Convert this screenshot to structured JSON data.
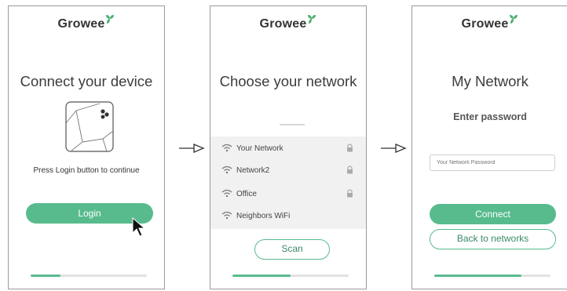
{
  "brand": {
    "name": "Growee",
    "accent": "#58bb8e"
  },
  "screen1": {
    "title": "Connect your device",
    "hint": "Press Login button to continue",
    "login_label": "Login",
    "progress": 0.26
  },
  "screen2": {
    "title": "Choose your network",
    "networks": [
      {
        "name": "Your Network",
        "locked": true
      },
      {
        "name": "Network2",
        "locked": true
      },
      {
        "name": "Office",
        "locked": true
      },
      {
        "name": "Neighbors WiFi",
        "locked": false
      }
    ],
    "scan_label": "Scan",
    "progress": 0.5
  },
  "screen3": {
    "title": "My Network",
    "subtitle": "Enter password",
    "password_placeholder": "Your Network Password",
    "connect_label": "Connect",
    "back_label": "Back to networks",
    "progress": 0.75
  },
  "icons": [
    "arrow-right-icon",
    "wifi-icon",
    "lock-icon",
    "leaf-logo-icon",
    "cursor-icon",
    "device-icon"
  ]
}
